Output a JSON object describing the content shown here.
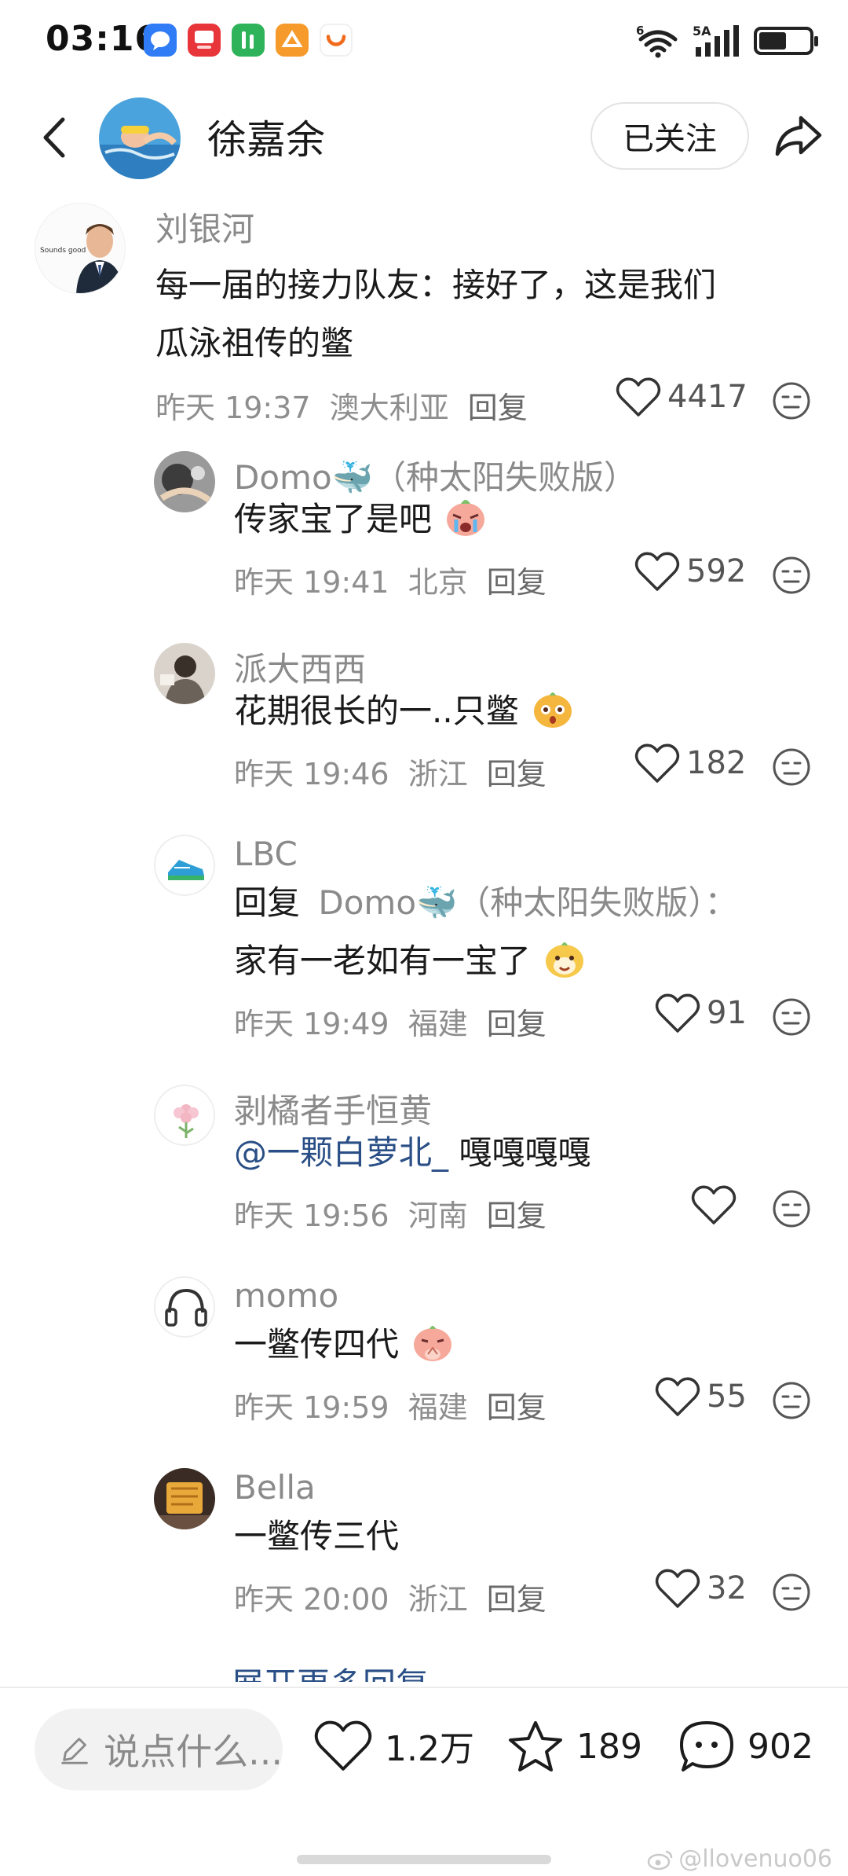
{
  "status_bar": {
    "time": "03:16",
    "network_left": "6",
    "network_right": "5A"
  },
  "header": {
    "title": "徐嘉余",
    "follow_label": "已关注"
  },
  "comments": [
    {
      "name": "刘银河",
      "avatar_caption": "Sounds good",
      "text_lines": [
        "每一届的接力队友：接好了，这是我们",
        "瓜泳祖传的鳖"
      ],
      "time": "昨天 19:37",
      "location": "澳大利亚",
      "reply_label": "回复",
      "likes": "4417"
    },
    {
      "name": "Domo🐳（种太阳失败版）",
      "text": "传家宝了是吧",
      "time": "昨天 19:41",
      "location": "北京",
      "reply_label": "回复",
      "likes": "592"
    },
    {
      "name": "派大西西",
      "text": "花期很长的一..只鳖",
      "time": "昨天 19:46",
      "location": "浙江",
      "reply_label": "回复",
      "likes": "182"
    },
    {
      "name": "LBC",
      "reply_prefix": "回复",
      "reply_target": "Domo🐳（种太阳失败版）：",
      "text": "家有一老如有一宝了",
      "time": "昨天 19:49",
      "location": "福建",
      "reply_label": "回复",
      "likes": "91"
    },
    {
      "name": "剥橘者手恒黄",
      "mention": "@一颗白萝北_",
      "text": " 嘎嘎嘎嘎",
      "time": "昨天 19:56",
      "location": "河南",
      "reply_label": "回复",
      "likes": ""
    },
    {
      "name": "momo",
      "text": "一鳖传四代",
      "time": "昨天 19:59",
      "location": "福建",
      "reply_label": "回复",
      "likes": "55"
    },
    {
      "name": "Bella",
      "text": "一鳖传三代",
      "time": "昨天 20:00",
      "location": "浙江",
      "reply_label": "回复",
      "likes": "32"
    }
  ],
  "more_replies_label": "展开更多回复",
  "bottom_bar": {
    "input_placeholder": "说点什么...",
    "likes": "1.2万",
    "favorites": "189",
    "comments": "902"
  },
  "watermark": "@llovenuo06",
  "colors": {
    "mention_blue": "#2a4f86",
    "meta_gray": "#8e8e8e"
  }
}
